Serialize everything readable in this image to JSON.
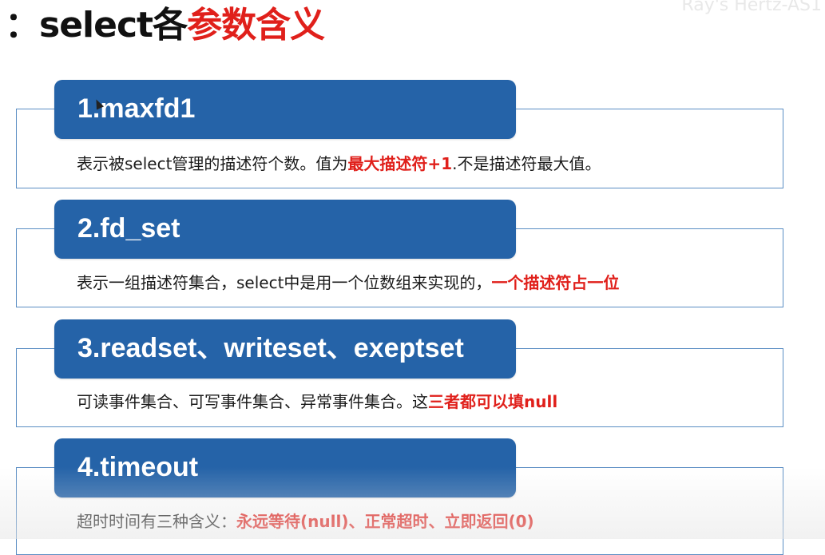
{
  "title": {
    "prefix": "：select各",
    "highlight": "参数含义"
  },
  "watermark": "Ray's Hertz-AS1",
  "sections": [
    {
      "header": "1.maxfd1",
      "desc_plain": "表示被select管理的描述符个数。值为",
      "desc_highlight": "最大描述符+1",
      "desc_tail": ".不是描述符最大值。"
    },
    {
      "header": "2.fd_set",
      "desc_plain": "表示一组描述符集合，select中是用一个位数组来实现的，",
      "desc_highlight": "一个描述符占一位",
      "desc_tail": ""
    },
    {
      "header": "3.readset、writeset、exeptset",
      "desc_plain": "可读事件集合、可写事件集合、异常事件集合。这",
      "desc_highlight": "三者都可以填null",
      "desc_tail": ""
    },
    {
      "header": "4.timeout",
      "desc_plain": "超时时间有三种含义：",
      "desc_highlight": "永远等待(null)、正常超时、立即返回(0)",
      "desc_tail": ""
    }
  ],
  "colors": {
    "header_bg": "#2563a8",
    "card_border": "#5b8ec4",
    "highlight_red": "#e0201b"
  }
}
